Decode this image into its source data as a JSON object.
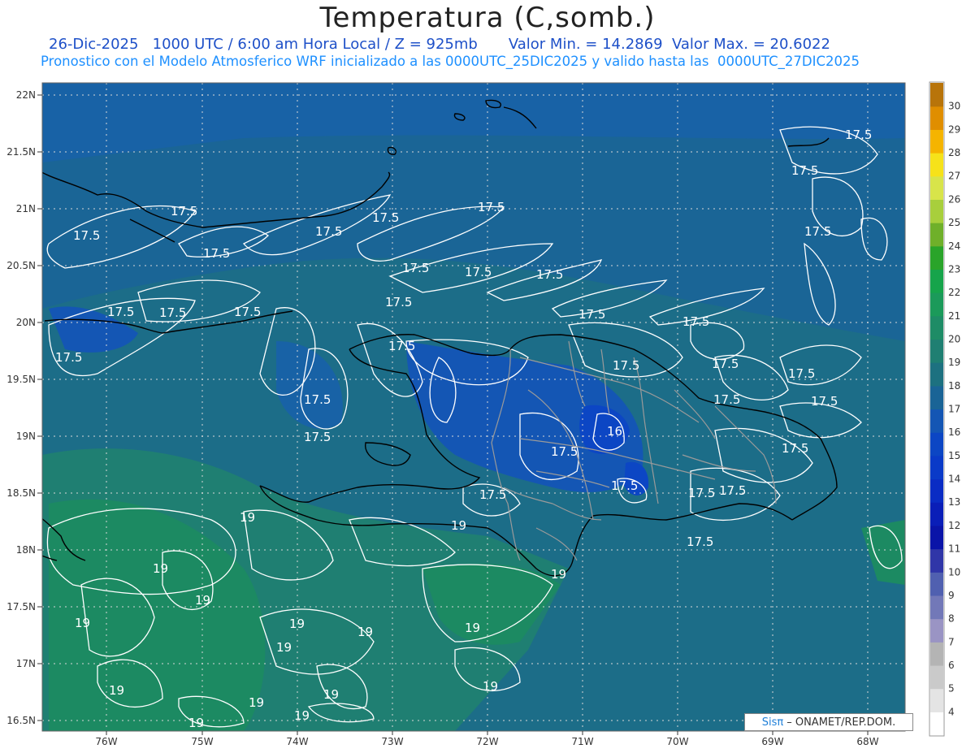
{
  "header": {
    "title": "Temperatura (C,somb.)",
    "date": "26-Dic-2025",
    "time_info": "1000 UTC / 6:00 am Hora Local / Z = 925mb",
    "min_label": "Valor Min. = 14.2869",
    "max_label": "Valor Max. = 20.6022",
    "model_info": "Pronostico con el Modelo Atmosferico WRF inicializado a las 0000UTC_25DIC2025 y valido hasta las  0000UTC_27DIC2025"
  },
  "axes": {
    "lat_labels": [
      "22N",
      "21.5N",
      "21N",
      "20.5N",
      "20N",
      "19.5N",
      "19N",
      "18.5N",
      "18N",
      "17.5N",
      "17N",
      "16.5N"
    ],
    "lon_labels": [
      "76W",
      "75W",
      "74W",
      "73W",
      "72W",
      "71W",
      "70W",
      "69W",
      "68W"
    ]
  },
  "colorbar": {
    "labels": [
      "30",
      "29",
      "28",
      "27",
      "26",
      "25",
      "24",
      "23",
      "22",
      "21",
      "20",
      "19",
      "18",
      "17",
      "16",
      "15",
      "14",
      "13",
      "12",
      "11",
      "10",
      "9",
      "8",
      "7",
      "6",
      "5",
      "4"
    ],
    "colors": [
      "#b8740a",
      "#e08e00",
      "#f5b400",
      "#f6e21a",
      "#d8e44a",
      "#a8cf3c",
      "#6fb02a",
      "#2aa42a",
      "#16a44b",
      "#1b9a5a",
      "#1e8c66",
      "#1f7f72",
      "#1d7180",
      "#1a6496",
      "#1456b4",
      "#0c46c4",
      "#0a3ac8",
      "#0a2cc4",
      "#0a1eb8",
      "#0a14a8",
      "#3036a8",
      "#5060b0",
      "#7278b8",
      "#9a94c4",
      "#b4b4b4",
      "#cacaca",
      "#e4e4e4",
      "#ffffff"
    ]
  },
  "contours": {
    "label_17_5": "17.5",
    "label_19": "19",
    "label_16": "16"
  },
  "credit": {
    "logo": "Sisπ",
    "text": "– ONAMET/REP.DOM."
  }
}
